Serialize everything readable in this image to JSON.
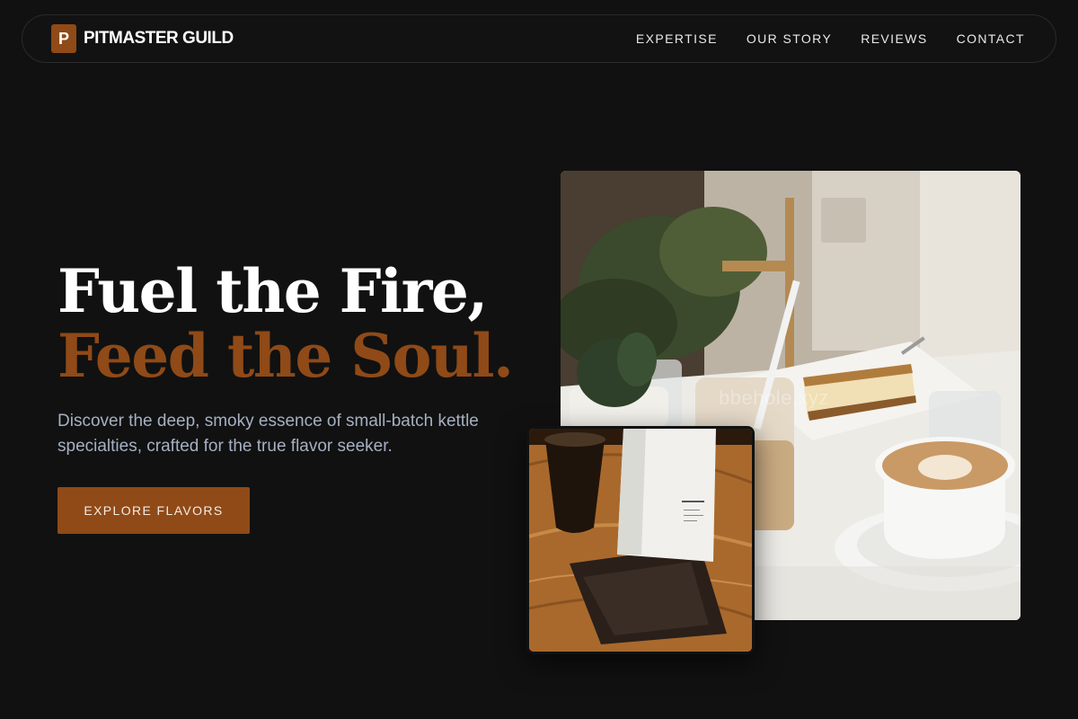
{
  "brand": {
    "mark": "P",
    "name": "PITMASTER GUILD",
    "accent": "#8f4a17"
  },
  "nav": {
    "links": [
      "EXPERTISE",
      "OUR STORY",
      "REVIEWS",
      "CONTACT"
    ]
  },
  "hero": {
    "headline_line1": "Fuel the Fire,",
    "headline_line2": "Feed the Soul.",
    "subtitle": "Discover the deep, smoky essence of small-batch kettle specialties, crafted for the true flavor seeker.",
    "cta_label": "EXPLORE FLAVORS"
  },
  "images": {
    "main_watermark": "bbehole.xyz"
  },
  "colors": {
    "background": "#111111",
    "subtitle": "#a6b0c2",
    "accent": "#8f4a17"
  }
}
